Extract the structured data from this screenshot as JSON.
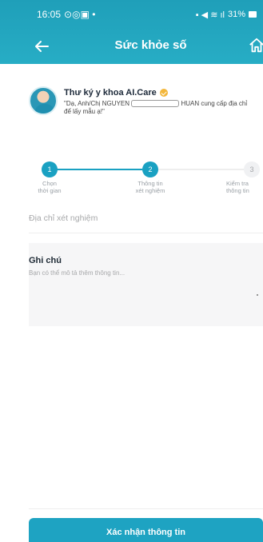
{
  "status_bar": {
    "time": "16:05",
    "battery": "31%"
  },
  "header": {
    "title": "Sức khỏe số"
  },
  "assistant": {
    "name": "Thư ký y khoa AI.Care",
    "message_prefix": "\"Dạ, Anh/Chị NGUYEN",
    "message_suffix": "HUAN cung cấp địa chỉ",
    "message_line2": "để lấy mẫu ạ!\""
  },
  "stepper": {
    "steps": [
      {
        "number": "1",
        "label_line1": "Chọn",
        "label_line2": "thời gian",
        "state": "completed"
      },
      {
        "number": "2",
        "label_line1": "Thông tin",
        "label_line2": "xét nghiệm",
        "state": "current"
      },
      {
        "number": "3",
        "label_line1": "Kiểm tra",
        "label_line2": "thông tin",
        "state": "pending"
      }
    ]
  },
  "form": {
    "address_placeholder": "Địa chỉ xét nghiệm",
    "notes_title": "Ghi chú",
    "notes_placeholder": "Bạn có thể mô tả thêm thông tin..."
  },
  "footer": {
    "confirm_label": "Xác nhận thông tin"
  },
  "colors": {
    "header": "#27adc5",
    "accent": "#1aa1c2",
    "button": "#1ea3c2"
  }
}
